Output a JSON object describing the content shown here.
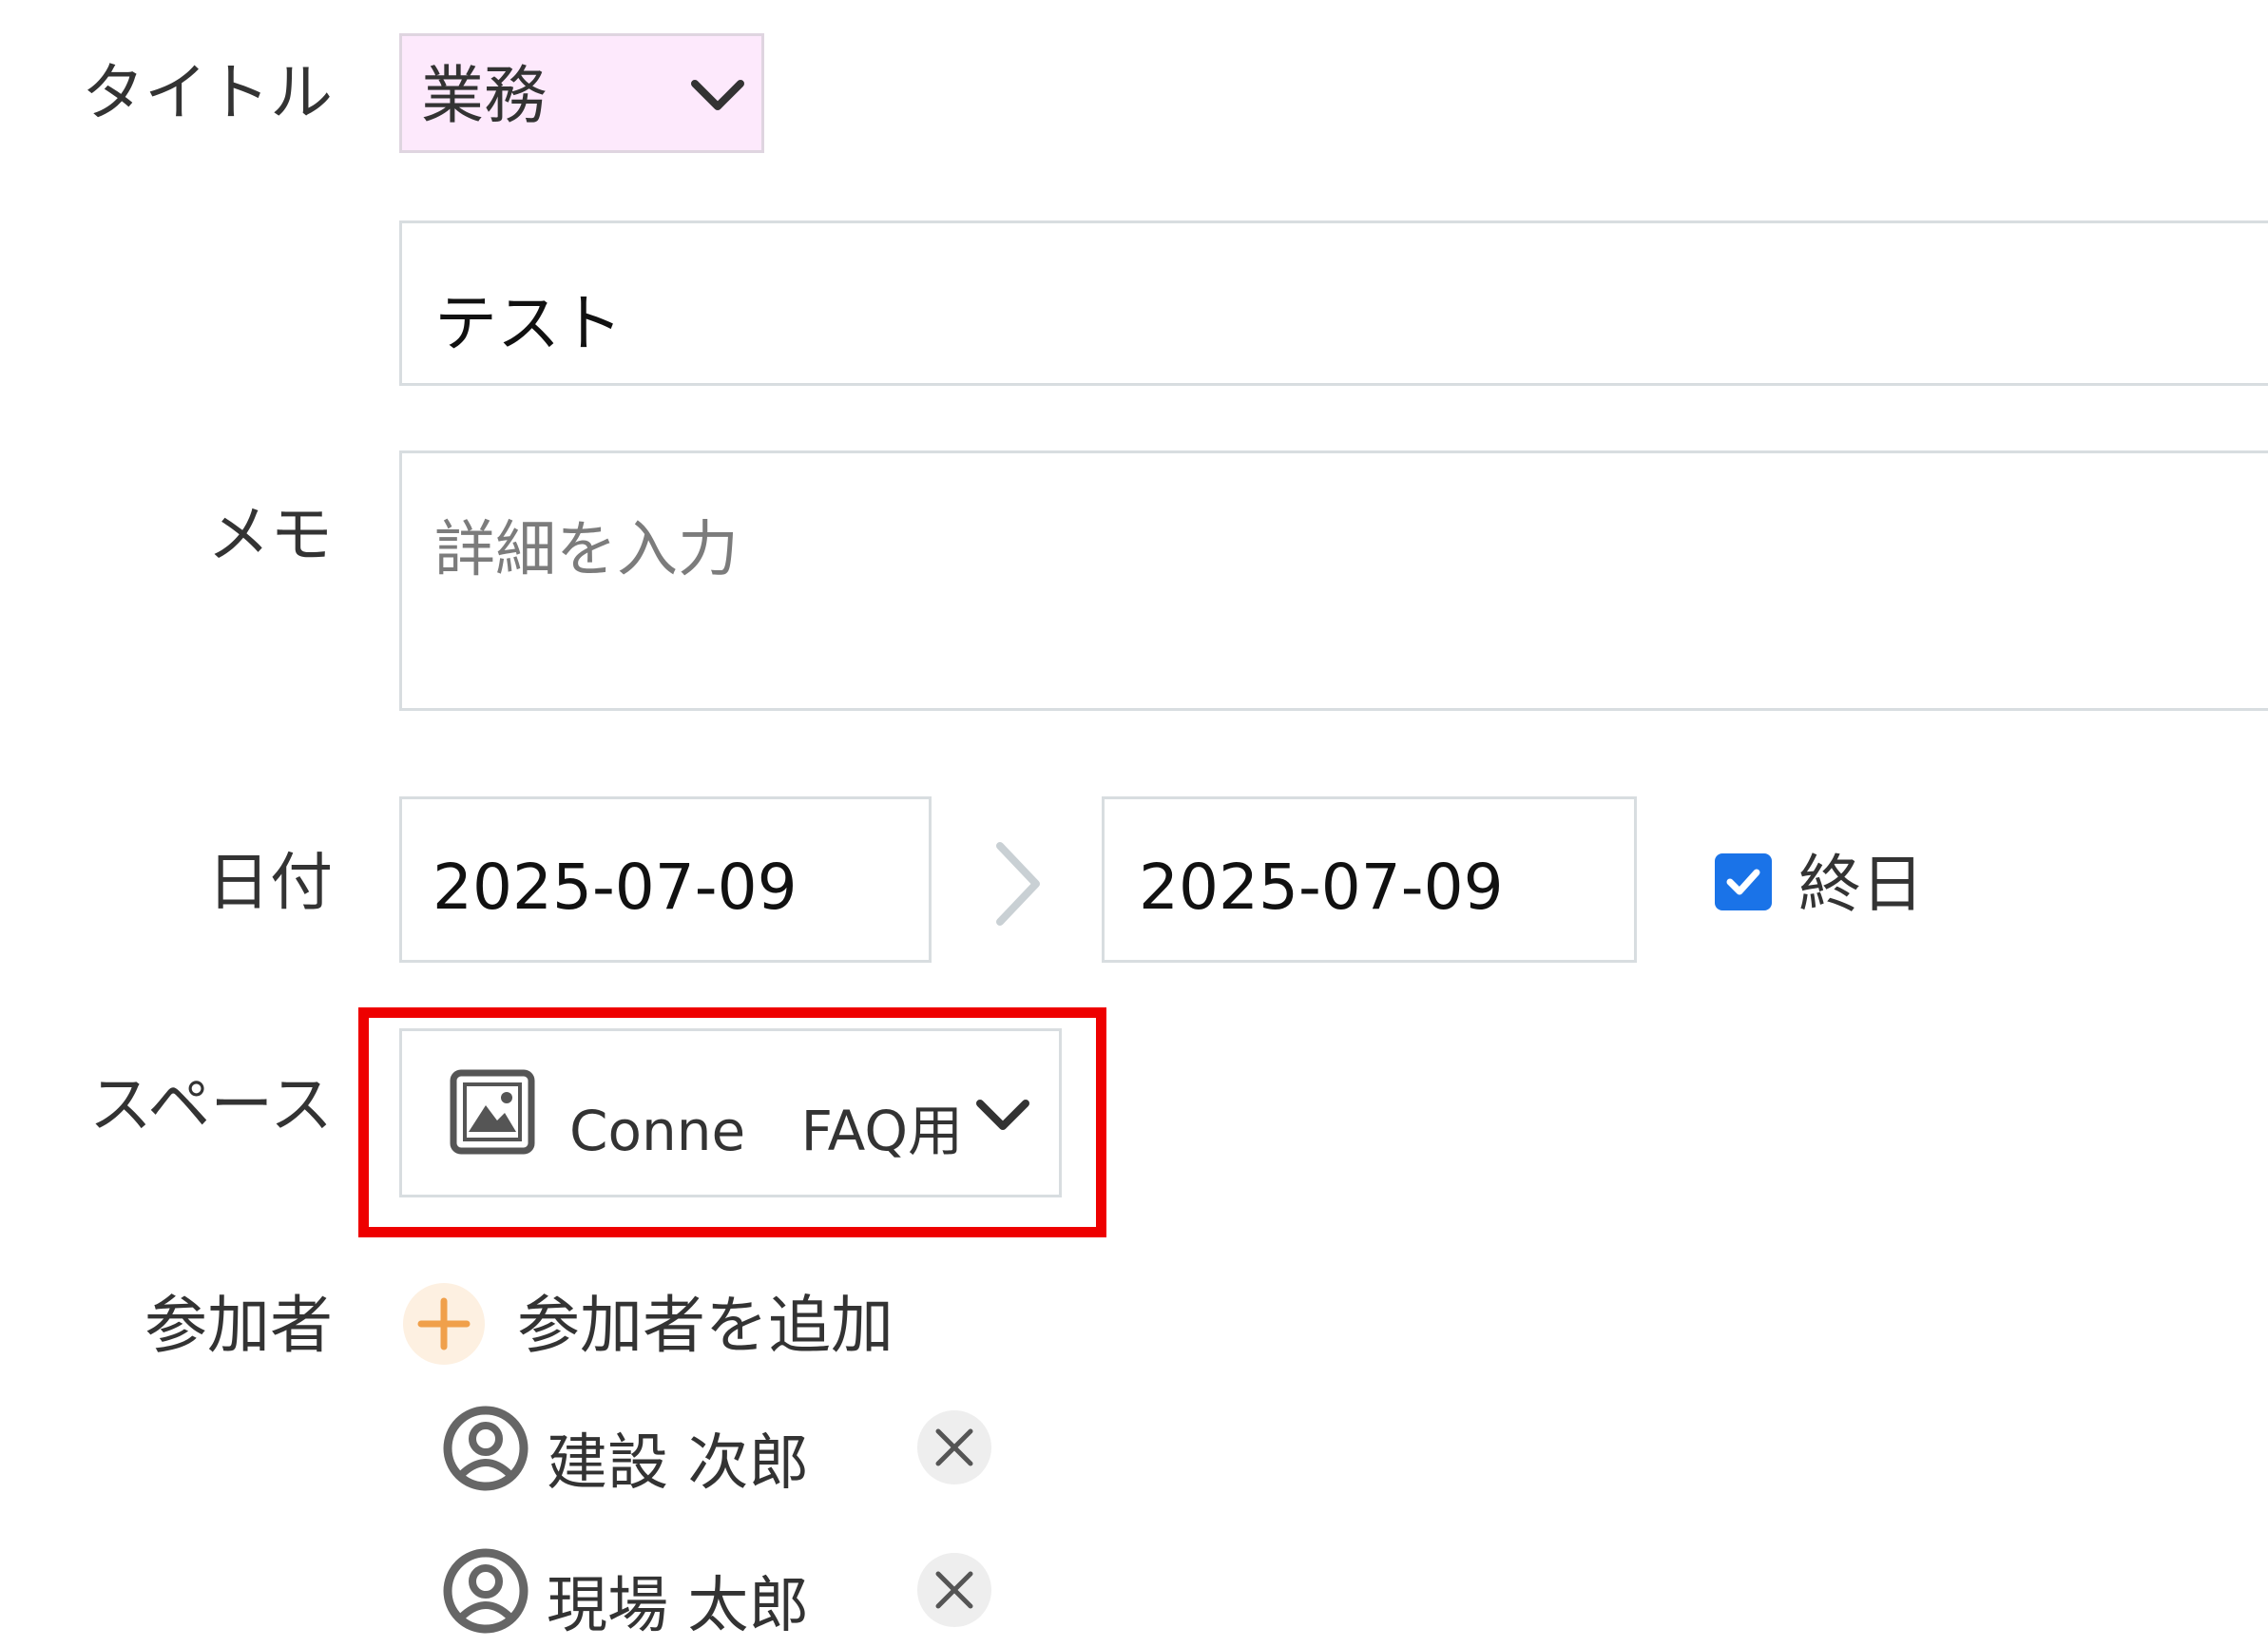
{
  "form": {
    "title": {
      "label": "タイトル",
      "category": "業務",
      "value": "テスト"
    },
    "memo": {
      "label": "メモ",
      "placeholder": "詳細を入力"
    },
    "date": {
      "label": "日付",
      "start": "2025-07-09",
      "end": "2025-07-09",
      "all_day_label": "終日",
      "all_day_checked": true
    },
    "space": {
      "label": "スペース",
      "name": "Conne FAQ用"
    },
    "participants": {
      "label": "参加者",
      "add_label": "参加者を追加",
      "list": [
        {
          "name": "建設 次郎"
        },
        {
          "name": "現場 太郎"
        }
      ]
    }
  },
  "colors": {
    "category_bg": "#fde9fc",
    "checkbox": "#1a73e8",
    "add_icon": "#f0a04b",
    "add_icon_bg": "#fdf0e1",
    "highlight": "#ee0000"
  }
}
